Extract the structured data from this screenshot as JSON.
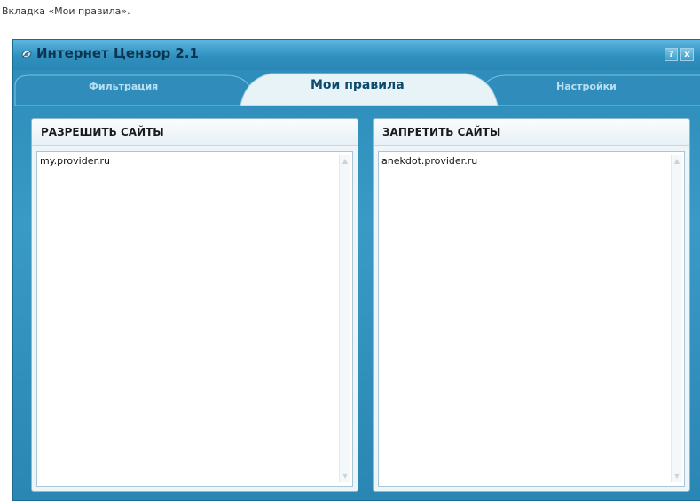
{
  "caption": "Вкладка «Мои правила».",
  "window": {
    "title": "Интернет Цензор 2.1",
    "help_label": "?",
    "close_label": "x"
  },
  "tabs": [
    {
      "label": "Фильтрация",
      "active": false
    },
    {
      "label": "Мои правила",
      "active": true
    },
    {
      "label": "Настройки",
      "active": false
    }
  ],
  "allow_panel": {
    "title": "РАЗРЕШИТЬ САЙТЫ",
    "items": [
      "my.provider.ru"
    ]
  },
  "deny_panel": {
    "title": "ЗАПРЕТИТЬ САЙТЫ",
    "items": [
      "anekdot.provider.ru"
    ]
  },
  "colors": {
    "window_blue": "#2b8ab7",
    "active_tab": "#e8f3f8",
    "panel_bg": "#eef5f9"
  },
  "icons": {
    "app": "app-logo-icon",
    "help": "help-icon",
    "close": "close-icon"
  }
}
